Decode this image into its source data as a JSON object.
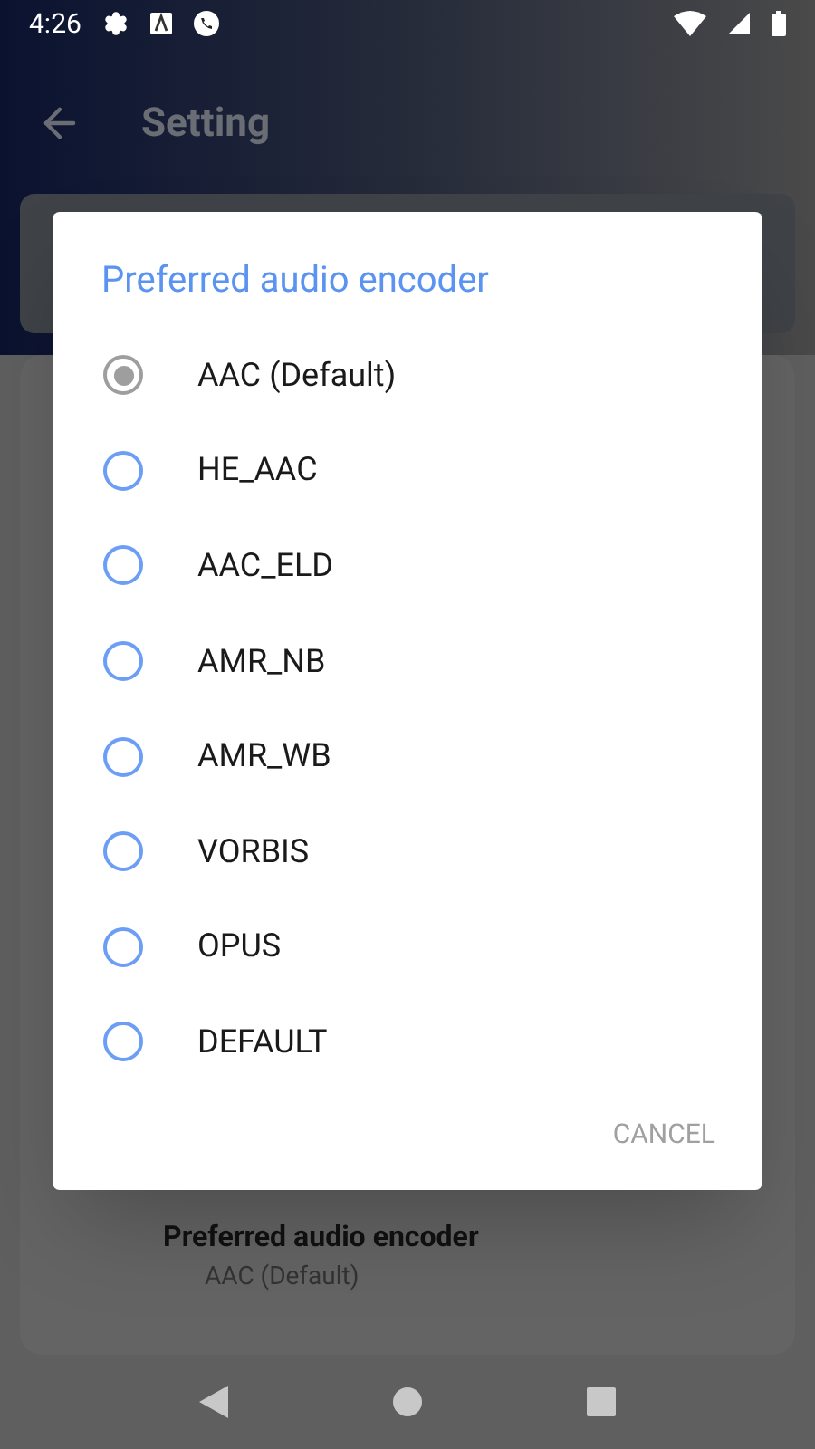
{
  "status_bar": {
    "time": "4:26"
  },
  "toolbar": {
    "title": "Setting"
  },
  "background_setting": {
    "title": "Preferred audio encoder",
    "value": "AAC (Default)"
  },
  "dialog": {
    "title": "Preferred audio encoder",
    "options": [
      {
        "label": "AAC (Default)",
        "selected": true
      },
      {
        "label": "HE_AAC",
        "selected": false
      },
      {
        "label": "AAC_ELD",
        "selected": false
      },
      {
        "label": "AMR_NB",
        "selected": false
      },
      {
        "label": "AMR_WB",
        "selected": false
      },
      {
        "label": "VORBIS",
        "selected": false
      },
      {
        "label": "OPUS",
        "selected": false
      },
      {
        "label": "DEFAULT",
        "selected": false
      }
    ],
    "cancel": "CANCEL"
  }
}
